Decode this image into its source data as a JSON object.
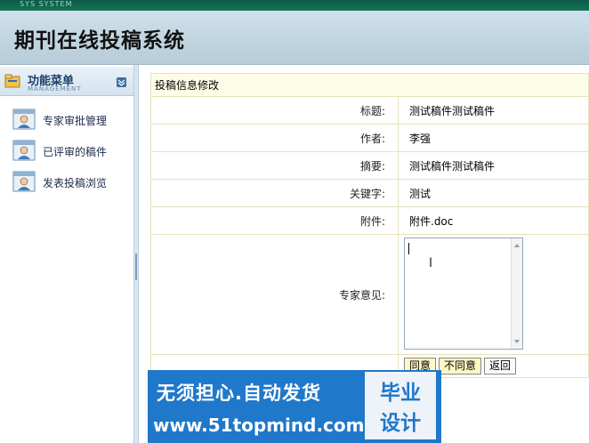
{
  "window": {
    "caption": "SYS SYSTEM"
  },
  "header": {
    "title": "期刊在线投稿系统"
  },
  "sidebar": {
    "title": "功能菜单",
    "subtitle": "MANAGEMENT",
    "items": [
      {
        "label": "专家审批管理",
        "icon": "user-card-icon"
      },
      {
        "label": "已评审的稿件",
        "icon": "user-card-icon"
      },
      {
        "label": "发表投稿浏览",
        "icon": "user-card-icon"
      }
    ]
  },
  "form": {
    "caption": "投稿信息修改",
    "fields": {
      "title": {
        "label": "标题:",
        "value": "测试稿件测试稿件"
      },
      "author": {
        "label": "作者:",
        "value": "李强"
      },
      "abstract": {
        "label": "摘要:",
        "value": "测试稿件测试稿件"
      },
      "keywords": {
        "label": "关键字:",
        "value": "测试"
      },
      "attachment": {
        "label": "附件:",
        "value": "附件.doc"
      },
      "opinion": {
        "label": "专家意见:",
        "value": ""
      }
    },
    "buttons": {
      "approve": "同意",
      "reject": "不同意",
      "back": "返回"
    }
  },
  "watermark": {
    "line1": "无须担心.自动发货",
    "line2": "www.51topmind.com",
    "badge_top": "毕业",
    "badge_bottom": "设计"
  },
  "colors": {
    "header_bg": "#bed2de",
    "watermark_bg": "#1f78c9",
    "table_border": "#e6e2b9",
    "button_bg": "#fff7c4"
  }
}
